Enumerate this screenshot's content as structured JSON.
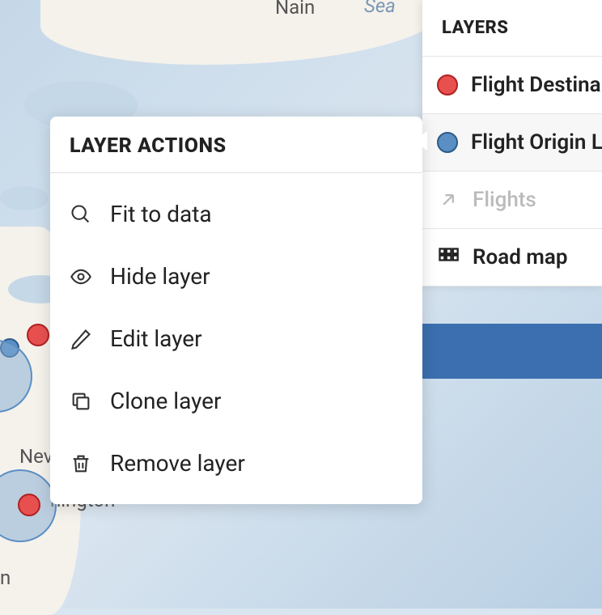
{
  "map": {
    "labels": {
      "nain": "Nain",
      "sea": "Sea",
      "nev": "Nev",
      "hington": "hington",
      "n": "n"
    }
  },
  "context_menu": {
    "title": "LAYER ACTIONS",
    "items": [
      {
        "label": "Fit to data",
        "icon": "magnify-icon"
      },
      {
        "label": "Hide layer",
        "icon": "eye-icon"
      },
      {
        "label": "Edit layer",
        "icon": "pencil-icon"
      },
      {
        "label": "Clone layer",
        "icon": "copy-icon"
      },
      {
        "label": "Remove layer",
        "icon": "trash-icon"
      }
    ]
  },
  "layers_panel": {
    "title": "LAYERS",
    "items": [
      {
        "label": "Flight Destina",
        "swatch": "red",
        "type": "point"
      },
      {
        "label": "Flight Origin L",
        "swatch": "blue",
        "type": "point",
        "active": true
      },
      {
        "label": "Flights",
        "icon": "expand-icon",
        "muted": true
      },
      {
        "label": "Road map",
        "icon": "grid-icon"
      }
    ]
  }
}
